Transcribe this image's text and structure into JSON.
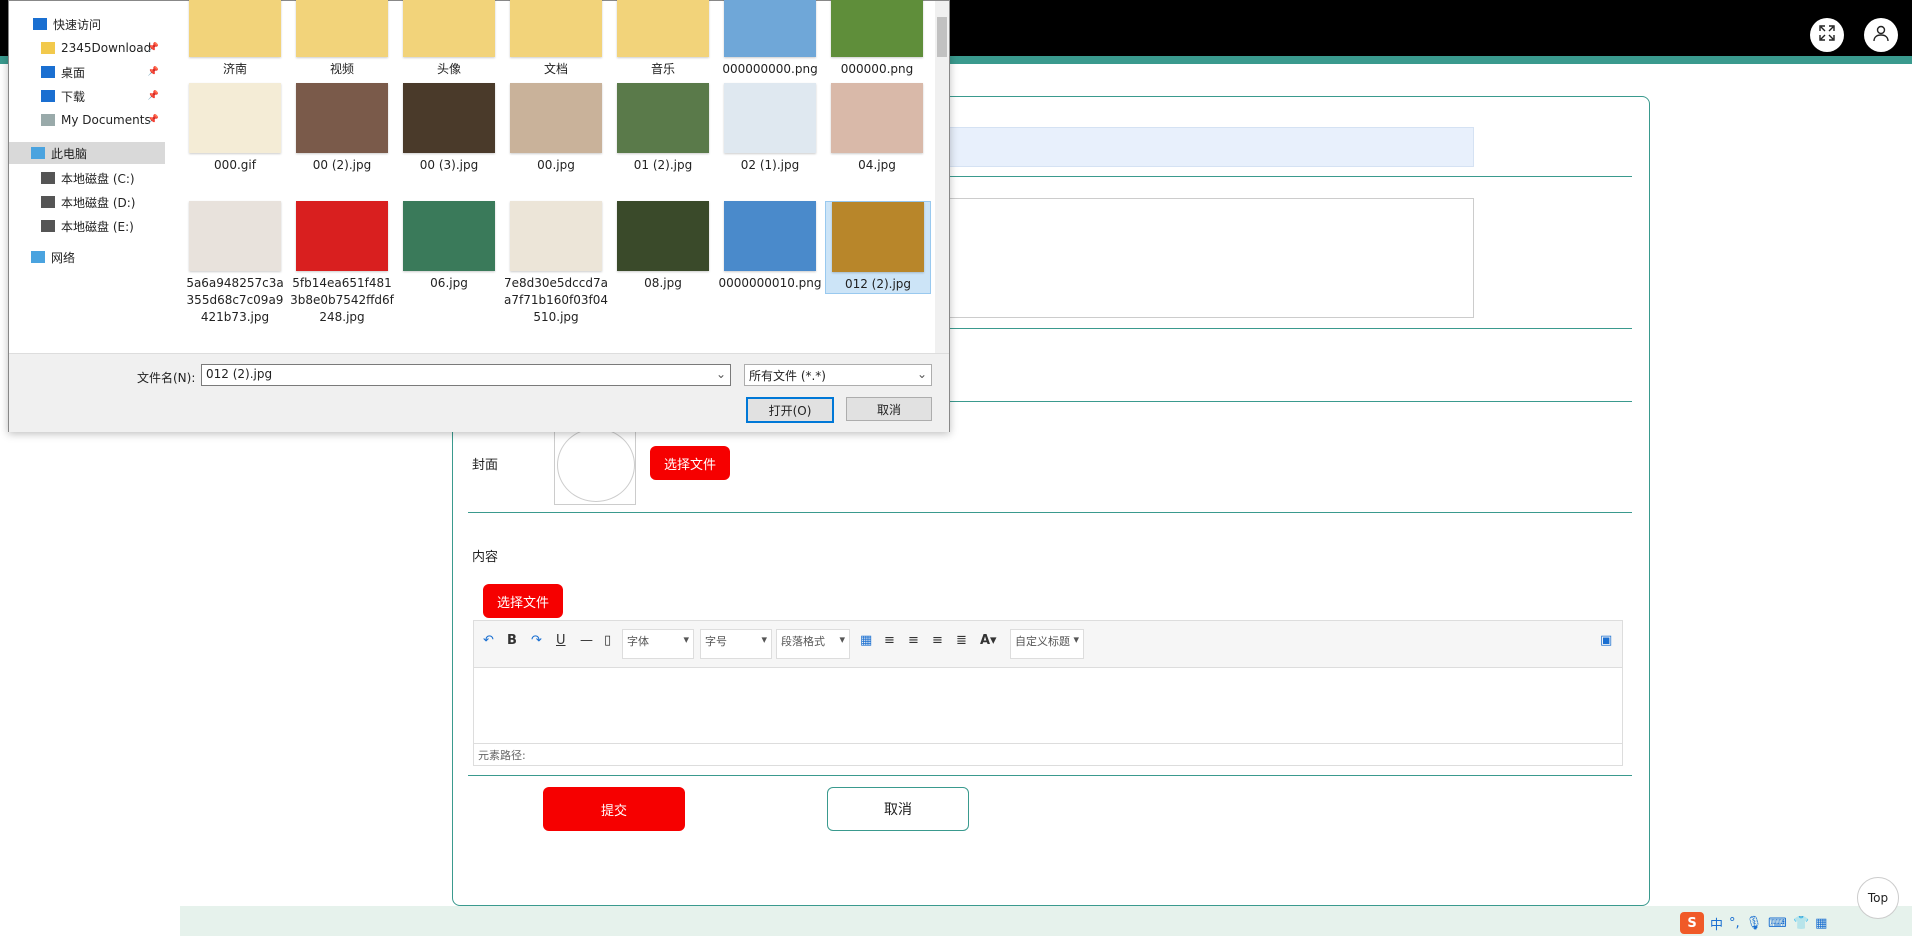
{
  "header": {
    "fullscreen_icon": "expand-icon",
    "user_icon": "user-icon"
  },
  "form": {
    "cover_label": "封面",
    "cover_button": "选择文件",
    "content_label": "内容",
    "content_button": "选择文件",
    "editor": {
      "font_select": "字体",
      "size_select": "字号",
      "paragraph_select": "段落格式",
      "custom_title_select": "自定义标题",
      "status_label": "元素路径:"
    },
    "submit_button": "提交",
    "cancel_button": "取消"
  },
  "top_link": "Top",
  "tray": {
    "ime": "中"
  },
  "dialog": {
    "nav": [
      {
        "label": "快速访问",
        "icon": "star-icon",
        "pinned": false
      },
      {
        "label": "2345Download",
        "icon": "folder-icon",
        "pinned": true
      },
      {
        "label": "桌面",
        "icon": "desktop-icon",
        "pinned": true
      },
      {
        "label": "下载",
        "icon": "download-icon",
        "pinned": true
      },
      {
        "label": "My Documents",
        "icon": "document-icon",
        "pinned": true
      },
      {
        "label": "此电脑",
        "icon": "computer-icon",
        "pinned": false,
        "selected": true
      },
      {
        "label": "本地磁盘 (C:)",
        "icon": "drive-icon",
        "pinned": false
      },
      {
        "label": "本地磁盘 (D:)",
        "icon": "drive-icon",
        "pinned": false
      },
      {
        "label": "本地磁盘 (E:)",
        "icon": "drive-icon",
        "pinned": false
      },
      {
        "label": "网络",
        "icon": "network-icon",
        "pinned": false
      }
    ],
    "files": [
      {
        "name": "济南",
        "kind": "folder",
        "color": "#c98b3a"
      },
      {
        "name": "视频",
        "kind": "folder",
        "color": "#1e88c9"
      },
      {
        "name": "头像",
        "kind": "folder",
        "color": "#7a6a5a"
      },
      {
        "name": "文档",
        "kind": "folder",
        "color": "#e3e3e3"
      },
      {
        "name": "音乐",
        "kind": "folder",
        "color": "#5aaee0"
      },
      {
        "name": "000000000.png",
        "kind": "image",
        "color": "#6fa7d8"
      },
      {
        "name": "000000.png",
        "kind": "image",
        "color": "#5f8e3a"
      },
      {
        "name": "000.gif",
        "kind": "image",
        "color": "#f4ecd6"
      },
      {
        "name": "00 (2).jpg",
        "kind": "image",
        "color": "#7a5a4a"
      },
      {
        "name": "00 (3).jpg",
        "kind": "image",
        "color": "#4a3a2a"
      },
      {
        "name": "00.jpg",
        "kind": "image",
        "color": "#c9b29a"
      },
      {
        "name": "01 (2).jpg",
        "kind": "image",
        "color": "#5a7a4a"
      },
      {
        "name": "02 (1).jpg",
        "kind": "image",
        "color": "#dfe8f0"
      },
      {
        "name": "04.jpg",
        "kind": "image",
        "color": "#d9b9a9"
      },
      {
        "name": "5a6a948257c3a355d68c7c09a9421b73.jpg",
        "kind": "image",
        "color": "#e8e2dc"
      },
      {
        "name": "5fb14ea651f4813b8e0b7542ffd6f248.jpg",
        "kind": "image",
        "color": "#d91f1f"
      },
      {
        "name": "06.jpg",
        "kind": "image",
        "color": "#3a7a5a"
      },
      {
        "name": "7e8d30e5dccd7aa7f71b160f03f04510.jpg",
        "kind": "image",
        "color": "#ece5d8"
      },
      {
        "name": "08.jpg",
        "kind": "image",
        "color": "#3a4a2a"
      },
      {
        "name": "0000000010.png",
        "kind": "image",
        "color": "#4a8acb"
      },
      {
        "name": "012 (2).jpg",
        "kind": "image",
        "color": "#b8862a",
        "selected": true
      }
    ],
    "filename_label": "文件名(N):",
    "filename_value": "012 (2).jpg",
    "filetype_value": "所有文件 (*.*)",
    "open_button": "打开(O)",
    "cancel_button": "取消"
  }
}
